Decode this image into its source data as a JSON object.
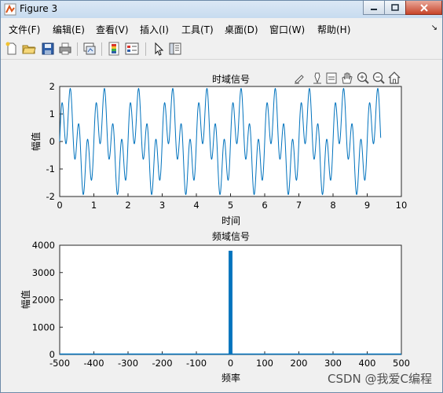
{
  "window": {
    "title": "Figure 3",
    "controls": [
      "minimize",
      "maximize",
      "close"
    ]
  },
  "menu": {
    "items": [
      "文件(F)",
      "编辑(E)",
      "查看(V)",
      "插入(I)",
      "工具(T)",
      "桌面(D)",
      "窗口(W)",
      "帮助(H)"
    ],
    "overflow_arrow": "↘"
  },
  "toolbar": {
    "icons": [
      "new-figure-icon",
      "open-file-icon",
      "save-icon",
      "print-icon",
      "link-plot-icon",
      "insert-colorbar-icon",
      "insert-legend-icon",
      "edit-plot-arrow-icon",
      "property-inspector-icon"
    ]
  },
  "axes_toolbar": {
    "icons": [
      "brush-icon",
      "data-tips-icon",
      "restore-view-icon",
      "pan-icon",
      "zoom-in-icon",
      "zoom-out-icon",
      "home-icon"
    ]
  },
  "watermark": "CSDN @我爱C编程",
  "chart_data": [
    {
      "type": "line",
      "title": "时域信号",
      "xlabel": "时间",
      "ylabel": "幅值",
      "xlim": [
        0,
        10
      ],
      "ylim": [
        -2,
        2
      ],
      "xticks": [
        "0",
        "1",
        "2",
        "3",
        "4",
        "5",
        "6",
        "7",
        "8",
        "9",
        "10"
      ],
      "yticks": [
        "-2",
        "-1",
        "0",
        "1",
        "2"
      ],
      "grid": false,
      "color": "#0072bd",
      "x_range": [
        0,
        9.4
      ],
      "signal": "sin(2*pi*1*t) + sin(2*pi*4*t)"
    },
    {
      "type": "line",
      "title": "频域信号",
      "xlabel": "频率",
      "ylabel": "幅值",
      "xlim": [
        -500,
        500
      ],
      "ylim": [
        0,
        4000
      ],
      "xticks": [
        "-500",
        "-400",
        "-300",
        "-200",
        "-100",
        "0",
        "100",
        "200",
        "300",
        "400",
        "500"
      ],
      "yticks": [
        "0",
        "1000",
        "2000",
        "3000",
        "4000"
      ],
      "grid": false,
      "color": "#0072bd",
      "peaks": [
        {
          "x": -4,
          "y": 3800
        },
        {
          "x": -1,
          "y": 3800
        },
        {
          "x": 1,
          "y": 3800
        },
        {
          "x": 4,
          "y": 3800
        }
      ]
    }
  ]
}
